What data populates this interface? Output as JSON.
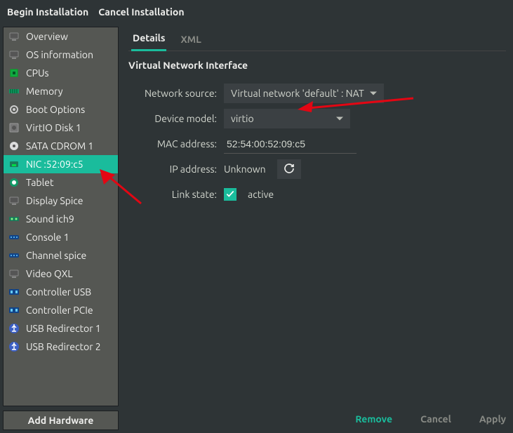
{
  "toolbar": {
    "begin": "Begin Installation",
    "cancel": "Cancel Installation"
  },
  "sidebar": {
    "items": [
      {
        "label": "Overview",
        "icon": "monitor"
      },
      {
        "label": "OS information",
        "icon": "monitor"
      },
      {
        "label": "CPUs",
        "icon": "cpu"
      },
      {
        "label": "Memory",
        "icon": "memory"
      },
      {
        "label": "Boot Options",
        "icon": "gear"
      },
      {
        "label": "VirtIO Disk 1",
        "icon": "disk"
      },
      {
        "label": "SATA CDROM 1",
        "icon": "cdrom"
      },
      {
        "label": "NIC :52:09:c5",
        "icon": "nic",
        "selected": true
      },
      {
        "label": "Tablet",
        "icon": "tablet"
      },
      {
        "label": "Display Spice",
        "icon": "monitor"
      },
      {
        "label": "Sound ich9",
        "icon": "sound"
      },
      {
        "label": "Console 1",
        "icon": "serial"
      },
      {
        "label": "Channel spice",
        "icon": "serial"
      },
      {
        "label": "Video QXL",
        "icon": "monitor"
      },
      {
        "label": "Controller USB",
        "icon": "usb-ctl"
      },
      {
        "label": "Controller PCIe",
        "icon": "usb-ctl"
      },
      {
        "label": "USB Redirector 1",
        "icon": "usb"
      },
      {
        "label": "USB Redirector 2",
        "icon": "usb"
      }
    ],
    "add_hw": "Add Hardware"
  },
  "tabs": {
    "details": "Details",
    "xml": "XML"
  },
  "panel": {
    "title": "Virtual Network Interface",
    "net_source_label": "Network source:",
    "net_source_value": "Virtual network 'default' : NAT",
    "device_model_label": "Device model:",
    "device_model_value": "virtio",
    "mac_label": "MAC address:",
    "mac_value": "52:54:00:52:09:c5",
    "ip_label": "IP address:",
    "ip_value": "Unknown",
    "link_label": "Link state:",
    "link_value": "active"
  },
  "footer": {
    "remove": "Remove",
    "cancel": "Cancel",
    "apply": "Apply"
  },
  "colors": {
    "accent": "#1abc9c"
  }
}
